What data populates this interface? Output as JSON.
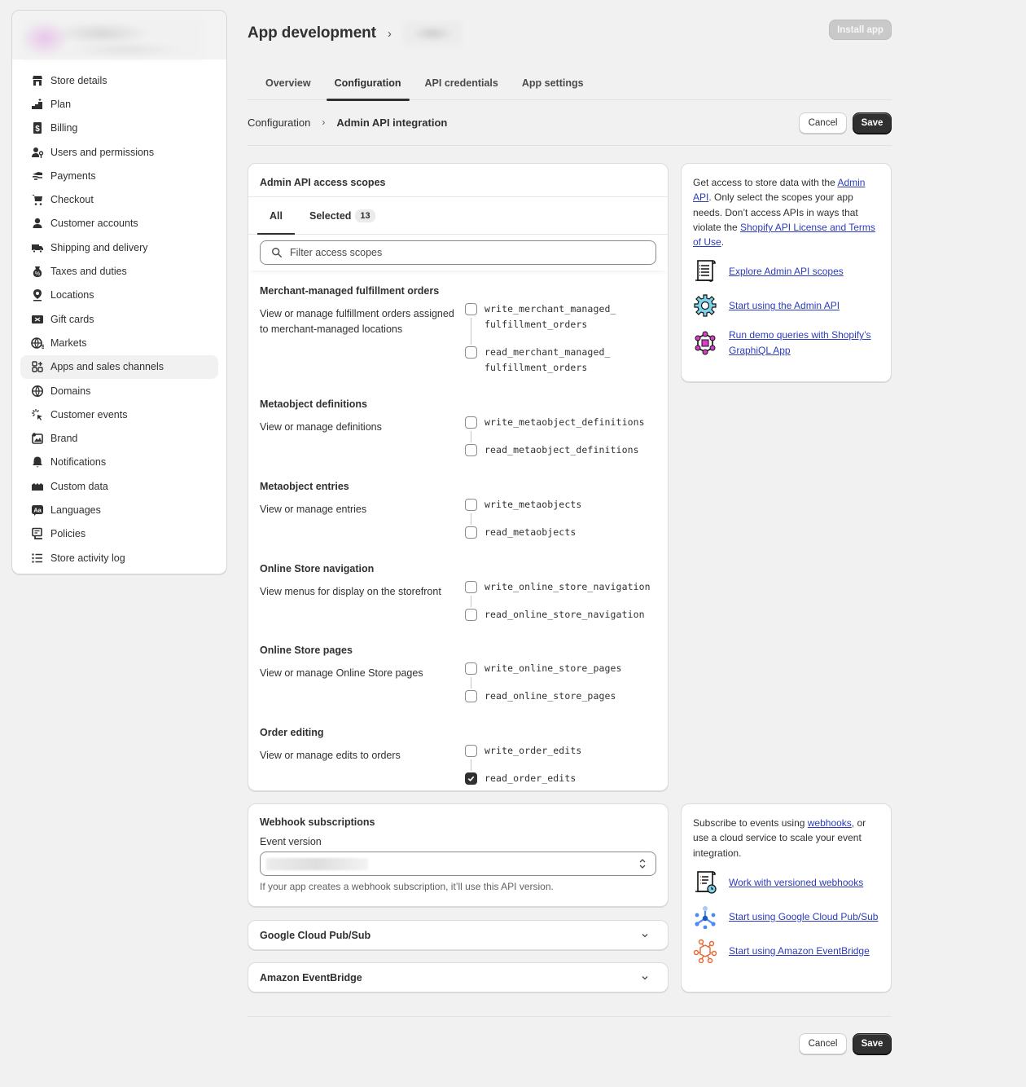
{
  "sidebar": {
    "items": [
      {
        "label": "Store details",
        "icon": "store-icon"
      },
      {
        "label": "Plan",
        "icon": "plan-icon"
      },
      {
        "label": "Billing",
        "icon": "billing-icon"
      },
      {
        "label": "Users and permissions",
        "icon": "users-icon"
      },
      {
        "label": "Payments",
        "icon": "payments-icon"
      },
      {
        "label": "Checkout",
        "icon": "cart-icon"
      },
      {
        "label": "Customer accounts",
        "icon": "person-icon"
      },
      {
        "label": "Shipping and delivery",
        "icon": "truck-icon"
      },
      {
        "label": "Taxes and duties",
        "icon": "tax-icon"
      },
      {
        "label": "Locations",
        "icon": "location-icon"
      },
      {
        "label": "Gift cards",
        "icon": "gift-card-icon"
      },
      {
        "label": "Markets",
        "icon": "globe-dollar-icon"
      },
      {
        "label": "Apps and sales channels",
        "icon": "apps-icon",
        "active": true
      },
      {
        "label": "Domains",
        "icon": "globe-icon"
      },
      {
        "label": "Customer events",
        "icon": "cursor-click-icon"
      },
      {
        "label": "Brand",
        "icon": "brand-icon"
      },
      {
        "label": "Notifications",
        "icon": "bell-icon"
      },
      {
        "label": "Custom data",
        "icon": "custom-data-icon"
      },
      {
        "label": "Languages",
        "icon": "language-icon"
      },
      {
        "label": "Policies",
        "icon": "policy-icon"
      },
      {
        "label": "Store activity log",
        "icon": "list-icon"
      }
    ]
  },
  "header": {
    "title": "App development",
    "install_label": "Install app"
  },
  "tabs": [
    {
      "label": "Overview"
    },
    {
      "label": "Configuration",
      "active": true
    },
    {
      "label": "API credentials"
    },
    {
      "label": "App settings"
    }
  ],
  "breadcrumb": {
    "parent": "Configuration",
    "current": "Admin API integration"
  },
  "actions": {
    "cancel": "Cancel",
    "save": "Save"
  },
  "scopes": {
    "title": "Admin API access scopes",
    "tab_all": "All",
    "tab_selected": "Selected",
    "selected_count": "13",
    "filter_placeholder": "Filter access scopes",
    "groups": [
      {
        "title": "Merchant-managed fulfillment orders",
        "description": "View or manage fulfillment orders assigned to merchant-managed locations",
        "items": [
          {
            "name": "write_merchant_managed_\nfulfillment_orders",
            "checked": false
          },
          {
            "name": "read_merchant_managed_\nfulfillment_orders",
            "checked": false
          }
        ]
      },
      {
        "title": "Metaobject definitions",
        "description": "View or manage definitions",
        "items": [
          {
            "name": "write_metaobject_definitions",
            "checked": false
          },
          {
            "name": "read_metaobject_definitions",
            "checked": false
          }
        ]
      },
      {
        "title": "Metaobject entries",
        "description": "View or manage entries",
        "items": [
          {
            "name": "write_metaobjects",
            "checked": false
          },
          {
            "name": "read_metaobjects",
            "checked": false
          }
        ]
      },
      {
        "title": "Online Store navigation",
        "description": "View menus for display on the storefront",
        "items": [
          {
            "name": "write_online_store_navigation",
            "checked": false
          },
          {
            "name": "read_online_store_navigation",
            "checked": false
          }
        ]
      },
      {
        "title": "Online Store pages",
        "description": "View or manage Online Store pages",
        "items": [
          {
            "name": "write_online_store_pages",
            "checked": false
          },
          {
            "name": "read_online_store_pages",
            "checked": false
          }
        ]
      },
      {
        "title": "Order editing",
        "description": "View or manage edits to orders",
        "items": [
          {
            "name": "write_order_edits",
            "checked": false
          },
          {
            "name": "read_order_edits",
            "checked": true
          }
        ]
      }
    ]
  },
  "api_info": {
    "text_1": "Get access to store data with the ",
    "link_admin_api": "Admin API",
    "text_2": ". Only select the scopes your app needs. Don’t access APIs in ways that violate the ",
    "link_license": "Shopify API License and Terms of Use",
    "text_3": ".",
    "resources": [
      {
        "label": "Explore Admin API scopes",
        "icon": "scroll-doc-icon"
      },
      {
        "label": "Start using the Admin API",
        "icon": "gear-icon"
      },
      {
        "label": "Run demo queries with Shopify’s GraphiQL App",
        "icon": "graphql-icon"
      }
    ]
  },
  "webhooks": {
    "title": "Webhook subscriptions",
    "event_version_label": "Event version",
    "help": "If your app creates a webhook subscription, it’ll use this API version."
  },
  "accordions": [
    {
      "title": "Google Cloud Pub/Sub"
    },
    {
      "title": "Amazon EventBridge"
    }
  ],
  "webhook_info": {
    "text_1": "Subscribe to events using ",
    "link_webhooks": "webhooks",
    "text_2": ", or use a cloud service to scale your event integration.",
    "resources": [
      {
        "label": "Work with versioned webhooks",
        "icon": "scroll-clock-icon"
      },
      {
        "label": "Start using Google Cloud Pub/Sub",
        "icon": "pubsub-icon"
      },
      {
        "label": "Start using Amazon EventBridge",
        "icon": "eventbridge-icon"
      }
    ]
  },
  "colors": {
    "primary_button": "#303030",
    "link": "#2c3cba",
    "background": "#f1f1f1"
  }
}
